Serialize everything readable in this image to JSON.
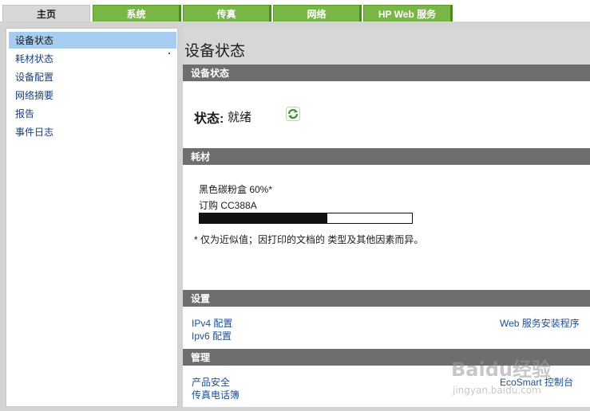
{
  "tabs": [
    {
      "label": "主页"
    },
    {
      "label": "系统"
    },
    {
      "label": "传真"
    },
    {
      "label": "网络"
    },
    {
      "label": "HP Web 服务"
    }
  ],
  "sidebar": {
    "items": [
      {
        "label": "设备状态"
      },
      {
        "label": "耗材状态"
      },
      {
        "label": "设备配置"
      },
      {
        "label": "网络摘要"
      },
      {
        "label": "报告"
      },
      {
        "label": "事件日志"
      }
    ]
  },
  "main": {
    "title": "设备状态",
    "status_section": {
      "header": "设备状态",
      "label": "状态:",
      "value": "就绪",
      "icon": "refresh-icon"
    },
    "supplies_section": {
      "header": "耗材",
      "cartridge": "黑色碳粉盒 60%*",
      "order": "订购 CC388A",
      "level_percent": 60,
      "note": "* 仅为近似值；因打印的文档的 类型及其他因素而异。"
    },
    "settings_section": {
      "header": "设置",
      "links": [
        "IPv4 配置",
        "Ipv6 配置"
      ],
      "right_link": "Web 服务安装程序"
    },
    "admin_section": {
      "header": "管理",
      "links": [
        "产品安全",
        "传真电话簿"
      ],
      "right_link": "EcoSmart 控制台"
    }
  },
  "watermark": {
    "text": "Baidu经验",
    "subtext": "jingyan.baidu.com"
  },
  "colors": {
    "tab_green": "#7ab547",
    "section_header": "#6e6e6e",
    "selected_nav": "#a6cdf0",
    "link": "#1f4f8f",
    "refresh_green": "#3f9a2a"
  }
}
